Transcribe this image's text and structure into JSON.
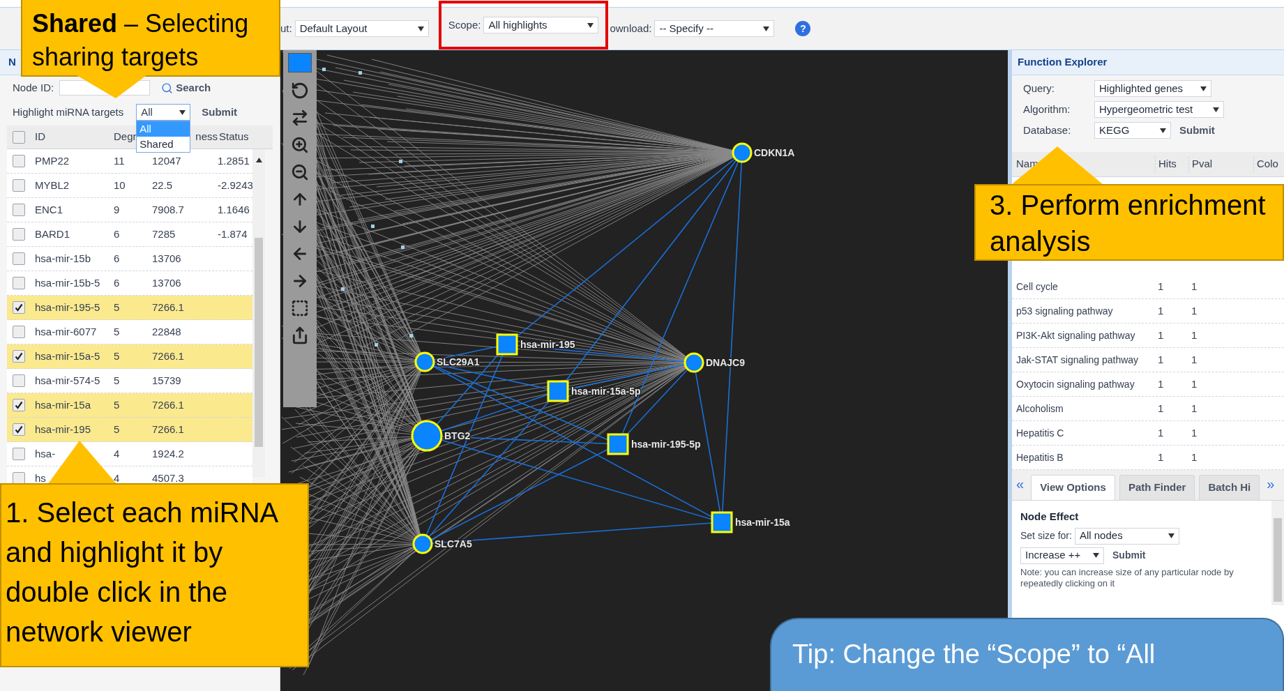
{
  "toolbar": {
    "layout": {
      "label": "ut:",
      "value": "Default Layout"
    },
    "scope": {
      "label": "Scope:",
      "value": "All highlights",
      "highlighted": true
    },
    "download": {
      "label": "ownload:",
      "value": "-- Specify --"
    },
    "help": "?"
  },
  "node_panel": {
    "title": "N",
    "node_id_label": "Node ID:",
    "search_button": "Search",
    "highlight_label": "Highlight miRNA targets",
    "highlight_value": "All",
    "options": [
      {
        "label": "All",
        "selected": true
      },
      {
        "label": "Shared",
        "selected": false
      }
    ],
    "submit": "Submit",
    "select_all_checked": false,
    "columns": [
      "ID",
      "Degr",
      "ness",
      "Status"
    ],
    "rows": [
      {
        "id": "PMP22",
        "degree": "11",
        "betweenness": "12047",
        "status": "1.2851",
        "checked": false
      },
      {
        "id": "MYBL2",
        "degree": "10",
        "betweenness": "22.5",
        "status": "-2.9243",
        "checked": false
      },
      {
        "id": "ENC1",
        "degree": "9",
        "betweenness": "7908.7",
        "status": "1.1646",
        "checked": false
      },
      {
        "id": "BARD1",
        "degree": "6",
        "betweenness": "7285",
        "status": "-1.874",
        "checked": false
      },
      {
        "id": "hsa-mir-15b",
        "degree": "6",
        "betweenness": "13706",
        "checked": false
      },
      {
        "id": "hsa-mir-15b-5",
        "degree": "6",
        "betweenness": "13706",
        "checked": false
      },
      {
        "id": "hsa-mir-195-5",
        "degree": "5",
        "betweenness": "7266.1",
        "checked": true
      },
      {
        "id": "hsa-mir-6077",
        "degree": "5",
        "betweenness": "22848",
        "checked": false
      },
      {
        "id": "hsa-mir-15a-5",
        "degree": "5",
        "betweenness": "7266.1",
        "checked": true
      },
      {
        "id": "hsa-mir-574-5",
        "degree": "5",
        "betweenness": "15739",
        "checked": false
      },
      {
        "id": "hsa-mir-15a",
        "degree": "5",
        "betweenness": "7266.1",
        "checked": true
      },
      {
        "id": "hsa-mir-195",
        "degree": "5",
        "betweenness": "7266.1",
        "checked": true
      },
      {
        "id": "hsa-",
        "degree": "4",
        "betweenness": "1924.2",
        "checked": false
      },
      {
        "id": "hs",
        "degree": "4",
        "betweenness": "4507.3",
        "checked": false
      }
    ]
  },
  "network": {
    "nodes": [
      {
        "label": "CDKN1A",
        "kind": "gene",
        "enlarged": false
      },
      {
        "label": "SLC29A1",
        "kind": "gene",
        "enlarged": false
      },
      {
        "label": "DNAJC9",
        "kind": "gene",
        "enlarged": false
      },
      {
        "label": "BTG2",
        "kind": "gene",
        "enlarged": true
      },
      {
        "label": "SLC7A5",
        "kind": "gene",
        "enlarged": false
      },
      {
        "label": "hsa-mir-195",
        "kind": "mirna",
        "enlarged": false
      },
      {
        "label": "hsa-mir-15a-5p",
        "kind": "mirna",
        "enlarged": false
      },
      {
        "label": "hsa-mir-195-5p",
        "kind": "mirna",
        "enlarged": false
      },
      {
        "label": "hsa-mir-15a",
        "kind": "mirna",
        "enlarged": false
      }
    ]
  },
  "function_explorer": {
    "title": "Function Explorer",
    "fields": [
      {
        "label": "Query:",
        "value": "Highlighted genes"
      },
      {
        "label": "Algorithm:",
        "value": "Hypergeometric test"
      },
      {
        "label": "Database:",
        "value": "KEGG"
      }
    ],
    "submit": "Submit",
    "columns": [
      "Nam",
      "Hits",
      "Pval",
      "Colo"
    ],
    "rows": [
      {
        "name": "Cell cycle",
        "hits": "1",
        "pval": "1"
      },
      {
        "name": "p53 signaling pathway",
        "hits": "1",
        "pval": "1"
      },
      {
        "name": "PI3K-Akt signaling pathway",
        "hits": "1",
        "pval": "1"
      },
      {
        "name": "Jak-STAT signaling pathway",
        "hits": "1",
        "pval": "1"
      },
      {
        "name": "Oxytocin signaling pathway",
        "hits": "1",
        "pval": "1"
      },
      {
        "name": "Alcoholism",
        "hits": "1",
        "pval": "1"
      },
      {
        "name": "Hepatitis C",
        "hits": "1",
        "pval": "1"
      },
      {
        "name": "Hepatitis B",
        "hits": "1",
        "pval": "1"
      }
    ]
  },
  "options_panel": {
    "prev": "«",
    "next": "»",
    "tabs": [
      {
        "label": "View Options",
        "selected": true
      },
      {
        "label": "Path Finder",
        "selected": false
      },
      {
        "label": "Batch Hi",
        "selected": false
      }
    ],
    "section": "Node Effect",
    "size_label": "Set size for:",
    "size_value": "All nodes",
    "change_value": "Increase ++",
    "submit": "Submit",
    "note": "Note: you can increase size of any particular node by repeatedly clicking on it"
  },
  "callouts": [
    {
      "text": "**Shared** – Selecting sharing targets"
    },
    {
      "text": "1. Select each miRNA and highlight it by double click in the network viewer"
    },
    {
      "text": "3. Perform enrichment analysis"
    }
  ],
  "tip": "Tip: Change the “Scope” to “All"
}
